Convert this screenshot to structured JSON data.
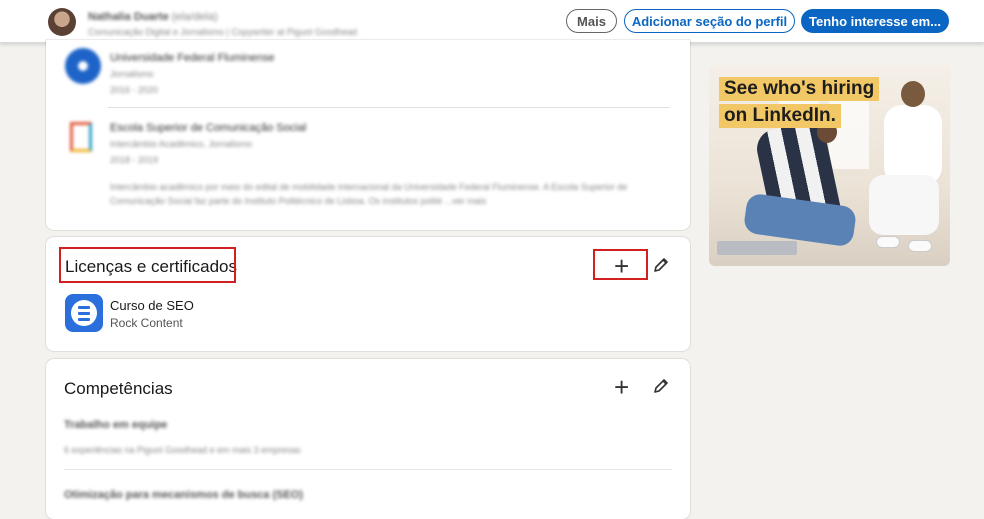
{
  "topbar": {
    "name": "Nathalia Duarte",
    "pronouns": "(ela/dela)",
    "subtitle": "Comunicação Digital e Jornalismo | Copywriter at Piguot Goodhead",
    "buttons": {
      "more": "Mais",
      "add_section": "Adicionar seção do perfil",
      "interested": "Tenho interesse em..."
    }
  },
  "education": {
    "items": [
      {
        "school": "Universidade Federal Fluminense",
        "degree": "Jornalismo",
        "dates": "2016 - 2020"
      },
      {
        "school": "Escola Superior de Comunicação Social",
        "degree": "Intercâmbio Acadêmico, Jornalismo",
        "dates": "2018 - 2019",
        "description": "Intercâmbio acadêmico por meio do edital de mobilidade internacional da Universidade Federal Fluminense. A Escola Superior de Comunicação Social faz parte do Instituto Politécnico de Lisboa. Os institutos polité",
        "more": "...ver mais"
      }
    ]
  },
  "licenses": {
    "title": "Licenças e certificados",
    "items": [
      {
        "name": "Curso de SEO",
        "issuer": "Rock Content"
      }
    ]
  },
  "skills": {
    "title": "Competências",
    "items": [
      {
        "name": "Trabalho em equipe",
        "endorsement": "6 experiências na Piguot Goodhead e em mais 3 empresas"
      },
      {
        "name": "Otimização para mecanismos de busca (SEO)"
      }
    ]
  },
  "ad": {
    "headline_line1": "See who's hiring",
    "headline_line2": "on LinkedIn."
  },
  "colors": {
    "primary": "#0a66c2",
    "highlight_box": "#d21f1f",
    "ad_highlight": "#f2c867",
    "cert_logo": "#2a6fdb"
  },
  "icons": [
    "plus-icon",
    "pencil-icon",
    "education-logo",
    "certificate-logo"
  ]
}
